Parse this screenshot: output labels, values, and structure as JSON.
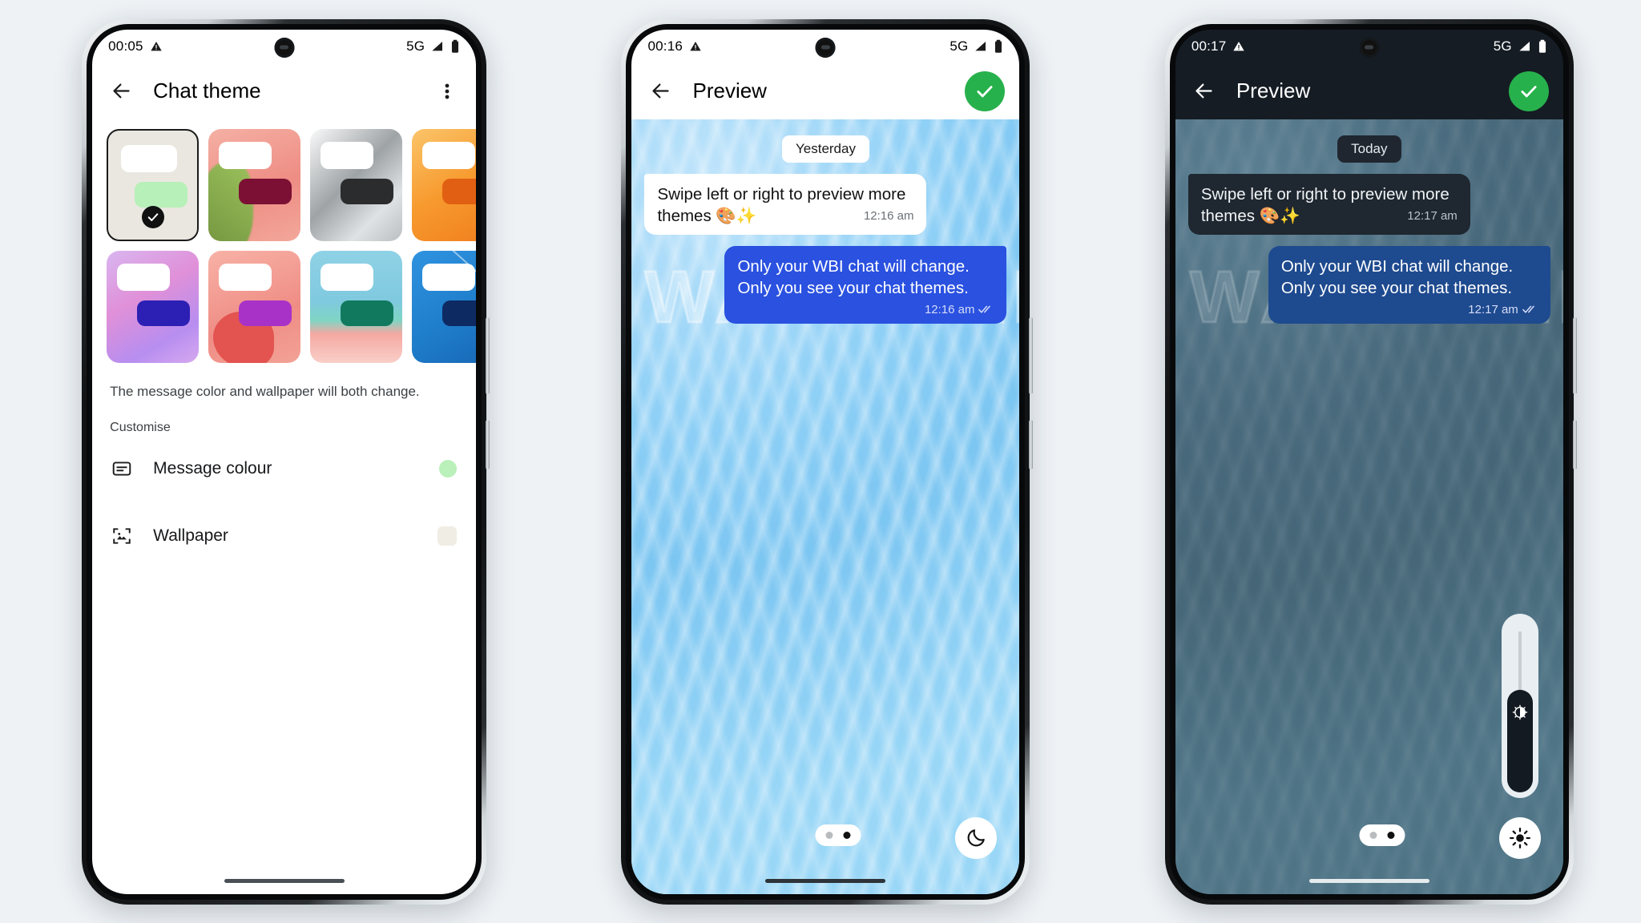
{
  "phones": [
    {
      "id": "chat-theme-picker",
      "status": {
        "time": "00:05",
        "alert_icon": "warning-triangle-icon",
        "network": "5G",
        "signal_icon": "signal-bars-icon",
        "battery_icon": "battery-full-icon"
      },
      "appbar": {
        "back_icon": "back-arrow-icon",
        "title": "Chat theme",
        "overflow_icon": "more-vertical-icon"
      },
      "themes": [
        {
          "name": "default",
          "selected": true,
          "bg": "#eae7e0",
          "out_bubble": "#b7f0b8"
        },
        {
          "name": "flower-coral",
          "selected": false,
          "bg": "#f0a094",
          "out_bubble": "#7c1034"
        },
        {
          "name": "silver",
          "selected": false,
          "bg": "#c8ccce",
          "out_bubble": "#2b2c2e"
        },
        {
          "name": "orange-sunset",
          "selected": false,
          "bg": "#f7a23c",
          "out_bubble": "#e05e12"
        },
        {
          "name": "lilac-aurora",
          "selected": false,
          "bg": "#cfa6e8",
          "out_bubble": "#2c20b4"
        },
        {
          "name": "coral-leaf",
          "selected": false,
          "bg": "#f39a92",
          "out_bubble": "#a832c8"
        },
        {
          "name": "beach",
          "selected": false,
          "bg": "#8ecfe0",
          "out_bubble": "#117a5e"
        },
        {
          "name": "blue-lines",
          "selected": false,
          "bg": "#2b8bd8",
          "out_bubble": "#0e2a63"
        }
      ],
      "caption": "The message color and wallpaper will both change.",
      "section_title": "Customise",
      "settings": [
        {
          "icon": "message-colour-icon",
          "label": "Message colour",
          "swatch": "#baf0ba",
          "swatch_shape": "circle"
        },
        {
          "icon": "wallpaper-image-icon",
          "label": "Wallpaper",
          "swatch": "#f0ede5",
          "swatch_shape": "square"
        }
      ]
    },
    {
      "id": "preview-light",
      "status": {
        "time": "00:16",
        "alert_icon": "warning-triangle-icon",
        "network": "5G",
        "signal_icon": "signal-bars-icon",
        "battery_icon": "battery-full-icon"
      },
      "appbar": {
        "back_icon": "back-arrow-icon",
        "title": "Preview",
        "confirm_icon": "check-icon",
        "confirm_color": "#27b14c"
      },
      "day_chip": "Yesterday",
      "messages": [
        {
          "dir": "in",
          "text": "Swipe left or right to preview more themes 🎨✨",
          "time": "12:16 am",
          "status_icon": null
        },
        {
          "dir": "out",
          "text": "Only your WBI chat will change. Only you see your chat themes.",
          "time": "12:16 am",
          "status_icon": "double-check-icon"
        }
      ],
      "pager": {
        "count": 2,
        "active_index": 1
      },
      "mode_button_icon": "moon-icon",
      "watermark": "WABETAINFO"
    },
    {
      "id": "preview-dark",
      "status": {
        "time": "00:17",
        "alert_icon": "warning-triangle-icon",
        "network": "5G",
        "signal_icon": "signal-bars-icon",
        "battery_icon": "battery-full-icon"
      },
      "appbar": {
        "back_icon": "back-arrow-icon",
        "title": "Preview",
        "confirm_icon": "check-icon",
        "confirm_color": "#27b14c"
      },
      "day_chip": "Today",
      "messages": [
        {
          "dir": "in",
          "text": "Swipe left or right to preview more themes 🎨✨",
          "time": "12:17 am",
          "status_icon": null
        },
        {
          "dir": "out",
          "text": "Only your WBI chat will change. Only you see your chat themes.",
          "time": "12:17 am",
          "status_icon": "double-check-icon"
        }
      ],
      "pager": {
        "count": 2,
        "active_index": 1
      },
      "mode_button_icon": "sun-icon",
      "brightness_slider": {
        "icon": "brightness-icon",
        "value_percent": 58
      },
      "watermark": "WABETAINFO"
    }
  ]
}
